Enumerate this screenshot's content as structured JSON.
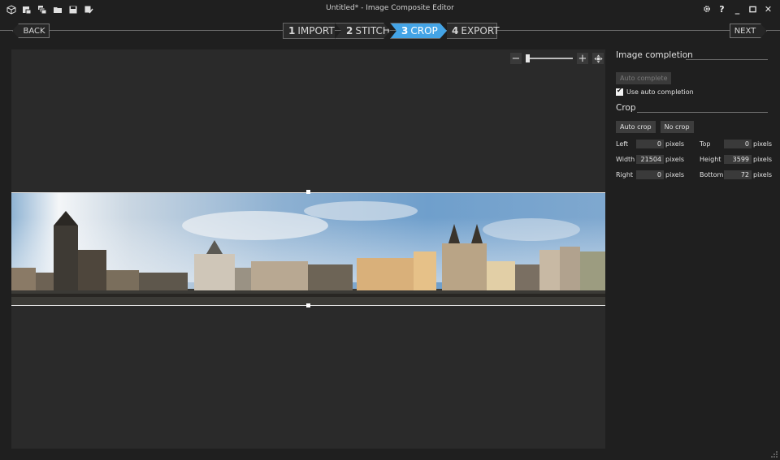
{
  "titlebar": {
    "title": "Untitled* - Image Composite Editor",
    "left_icons": [
      "new-project-icon",
      "open-project-icon",
      "open-images-icon",
      "folder-icon",
      "save-icon",
      "save-as-icon"
    ],
    "right_icons": [
      "settings-icon",
      "help-icon",
      "minimize-icon",
      "maximize-icon",
      "close-icon"
    ],
    "help_glyph": "?",
    "min_glyph": "_",
    "close_glyph": "✕"
  },
  "nav": {
    "back_label": "BACK",
    "next_label": "NEXT",
    "steps": [
      {
        "num": "1",
        "label": "IMPORT"
      },
      {
        "num": "2",
        "label": "STITCH"
      },
      {
        "num": "3",
        "label": "CROP"
      },
      {
        "num": "4",
        "label": "EXPORT"
      }
    ],
    "active_step": 3,
    "accent_color": "#44a4e6"
  },
  "zoom": {
    "minus": "−",
    "plus": "+",
    "level": 0
  },
  "image_completion": {
    "heading": "Image completion",
    "auto_complete_label": "Auto complete",
    "use_auto_label": "Use auto completion",
    "use_auto_checked": true
  },
  "crop": {
    "heading": "Crop",
    "auto_crop_label": "Auto crop",
    "no_crop_label": "No crop",
    "unit": "pixels",
    "fields": {
      "left": {
        "label": "Left",
        "value": "0"
      },
      "top": {
        "label": "Top",
        "value": "0"
      },
      "width": {
        "label": "Width",
        "value": "21504"
      },
      "height": {
        "label": "Height",
        "value": "3599"
      },
      "right": {
        "label": "Right",
        "value": "0"
      },
      "bottom": {
        "label": "Bottom",
        "value": "72"
      }
    }
  }
}
